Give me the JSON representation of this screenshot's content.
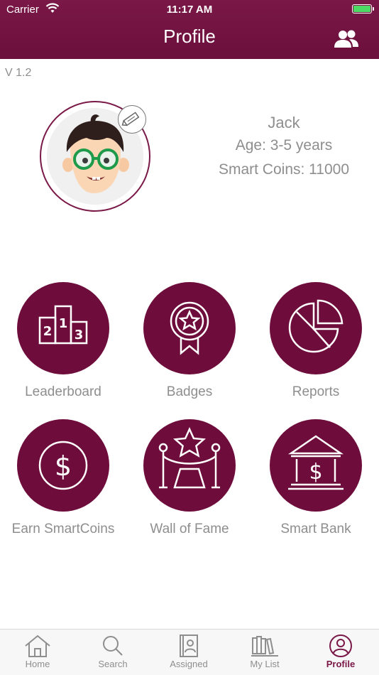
{
  "status_bar": {
    "carrier": "Carrier",
    "time": "11:17 AM"
  },
  "header": {
    "title": "Profile",
    "right_icon": "users-icon"
  },
  "version": "V 1.2",
  "profile": {
    "name": "Jack",
    "age": "Age: 3-5 years",
    "coins": "Smart Coins: 11000"
  },
  "tiles": [
    {
      "label": "Leaderboard",
      "icon": "podium-icon"
    },
    {
      "label": "Badges",
      "icon": "badge-icon"
    },
    {
      "label": "Reports",
      "icon": "pie-chart-icon"
    },
    {
      "label": "Earn SmartCoins",
      "icon": "dollar-coin-icon"
    },
    {
      "label": "Wall of Fame",
      "icon": "star-stage-icon"
    },
    {
      "label": "Smart Bank",
      "icon": "bank-icon"
    }
  ],
  "tabbar": {
    "items": [
      {
        "label": "Home",
        "icon": "home-icon"
      },
      {
        "label": "Search",
        "icon": "search-icon"
      },
      {
        "label": "Assigned",
        "icon": "assigned-book-icon"
      },
      {
        "label": "My List",
        "icon": "bookshelf-icon"
      },
      {
        "label": "Profile",
        "icon": "profile-icon"
      }
    ],
    "active": "Profile"
  },
  "colors": {
    "brand": "#6e0d3c",
    "header": "#7a1847",
    "text_muted": "#8e8e8e",
    "battery": "#4cd964"
  }
}
